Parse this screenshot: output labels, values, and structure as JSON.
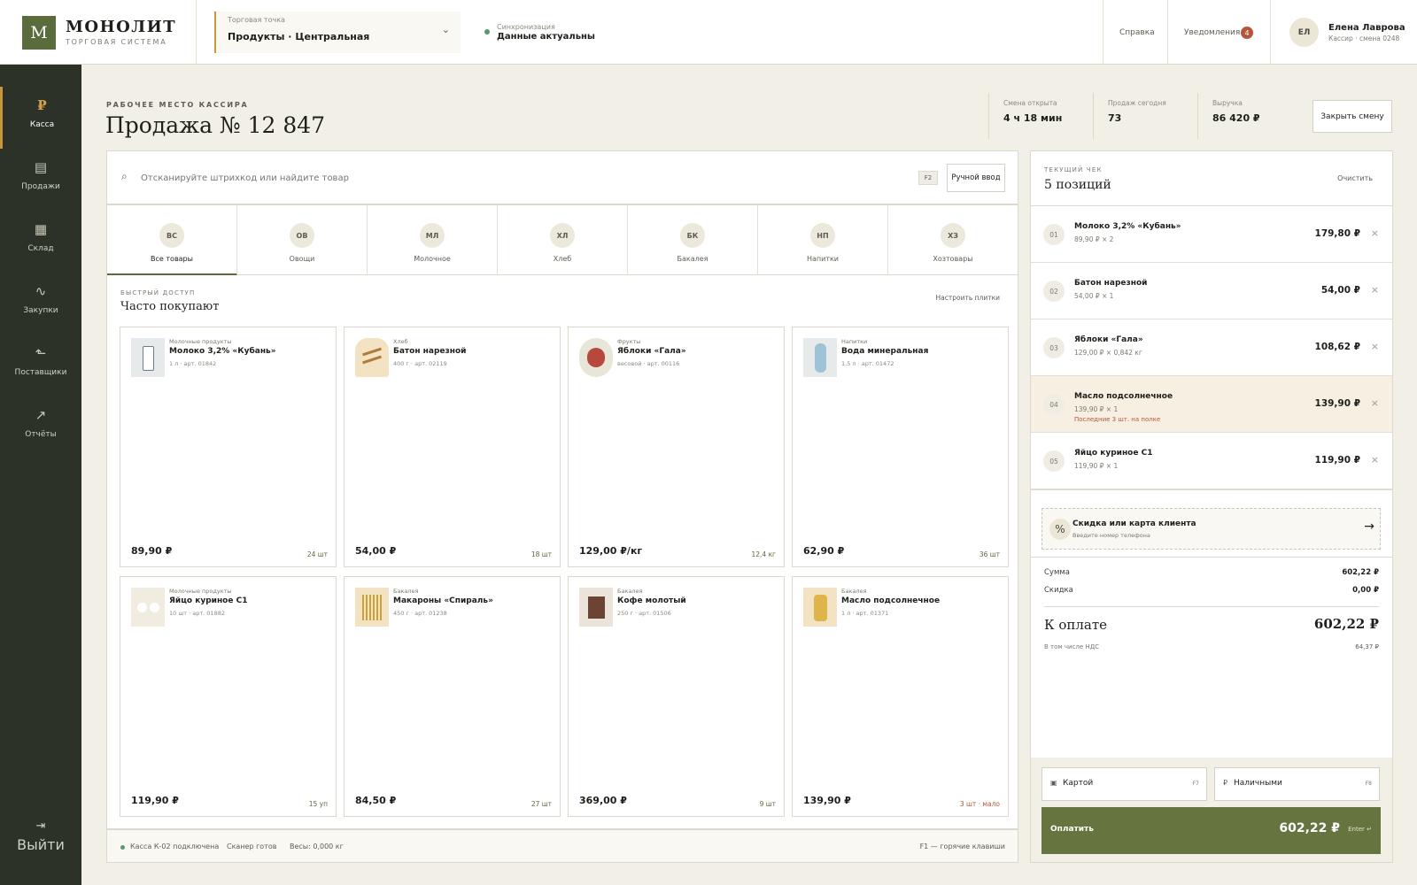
{
  "brand": {
    "logo": "М",
    "name": "МОНОЛИТ",
    "subtitle": "ТОРГОВАЯ СИСТЕМА"
  },
  "store": {
    "label": "Торговая точка",
    "value": "Продукты · Центральная"
  },
  "sync": {
    "label": "Синхронизация",
    "value": "Данные актуальны",
    "color": "#5a9a6a"
  },
  "header": {
    "help": "Справка",
    "notifications": "Уведомления",
    "notifications_count": "4"
  },
  "user": {
    "initials": "ЕЛ",
    "name": "Елена Лаврова",
    "role": "Кассир · смена 0248"
  },
  "sidebar": {
    "items": [
      {
        "icon": "ruble-icon",
        "glyph": "₽",
        "label": "Касса",
        "active": true
      },
      {
        "icon": "sales-icon",
        "glyph": "▤",
        "label": "Продажи"
      },
      {
        "icon": "warehouse-icon",
        "glyph": "▦",
        "label": "Склад"
      },
      {
        "icon": "purchases-icon",
        "glyph": "∿",
        "label": "Закупки"
      },
      {
        "icon": "suppliers-icon",
        "glyph": "⬑",
        "label": "Поставщики"
      },
      {
        "icon": "reports-icon",
        "glyph": "↗",
        "label": "Отчёты"
      }
    ],
    "logout": {
      "icon": "logout-icon",
      "glyph": "⇥",
      "label": "Выйти"
    }
  },
  "page": {
    "eyebrow": "РАБОЧЕЕ МЕСТО КАССИРА",
    "title": "Продажа № 12 847"
  },
  "stats": [
    {
      "label": "Смена открыта",
      "value": "4 ч 18 мин"
    },
    {
      "label": "Продаж сегодня",
      "value": "73"
    },
    {
      "label": "Выручка",
      "value": "86 420 ₽"
    }
  ],
  "close_shift": "Закрыть смену",
  "search": {
    "placeholder": "Отсканируйте штрихкод или найдите товар",
    "hotkey": "F2",
    "manual": "Ручной ввод"
  },
  "categories": [
    {
      "abbr": "ВС",
      "label": "Все товары",
      "active": true
    },
    {
      "abbr": "ОВ",
      "label": "Овощи"
    },
    {
      "abbr": "МЛ",
      "label": "Молочное"
    },
    {
      "abbr": "ХЛ",
      "label": "Хлеб"
    },
    {
      "abbr": "БК",
      "label": "Бакалея"
    },
    {
      "abbr": "НП",
      "label": "Напитки"
    },
    {
      "abbr": "ХЗ",
      "label": "Хозтовары"
    }
  ],
  "quick": {
    "eyebrow": "БЫСТРЫЙ ДОСТУП",
    "title": "Часто покупают",
    "configure": "Настроить плитки"
  },
  "products": [
    {
      "category": "Молочные продукты",
      "name": "Молоко 3,2% «Кубань»",
      "meta": "1 л · арт. 01842",
      "price": "89,90 ₽",
      "stock": "24 шт",
      "low": false,
      "thumb": "milk"
    },
    {
      "category": "Хлеб",
      "name": "Батон нарезной",
      "meta": "400 г · арт. 02119",
      "price": "54,00 ₽",
      "stock": "18 шт",
      "low": false,
      "thumb": "bread"
    },
    {
      "category": "Фрукты",
      "name": "Яблоки «Гала»",
      "meta": "весовой · арт. 00116",
      "price": "129,00 ₽/кг",
      "stock": "12,4 кг",
      "low": false,
      "thumb": "apple"
    },
    {
      "category": "Напитки",
      "name": "Вода минеральная",
      "meta": "1,5 л · арт. 01472",
      "price": "62,90 ₽",
      "stock": "36 шт",
      "low": false,
      "thumb": "water"
    },
    {
      "category": "Молочные продукты",
      "name": "Яйцо куриное С1",
      "meta": "10 шт · арт. 01882",
      "price": "119,90 ₽",
      "stock": "15 уп",
      "low": false,
      "thumb": "eggs"
    },
    {
      "category": "Бакалея",
      "name": "Макароны «Спираль»",
      "meta": "450 г · арт. 01238",
      "price": "84,50 ₽",
      "stock": "27 шт",
      "low": false,
      "thumb": "pasta"
    },
    {
      "category": "Бакалея",
      "name": "Кофе молотый",
      "meta": "250 г · арт. 01506",
      "price": "369,00 ₽",
      "stock": "9 шт",
      "low": false,
      "thumb": "coffee"
    },
    {
      "category": "Бакалея",
      "name": "Масло подсолнечное",
      "meta": "1 л · арт. 01371",
      "price": "139,90 ₽",
      "stock": "3 шт · мало",
      "low": true,
      "thumb": "oil"
    }
  ],
  "statusbar": {
    "register": "Касса К-02 подключена",
    "scanner": "Сканер готов",
    "scales": "Весы: 0,000 кг",
    "hotkeys": "F1 — горячие клавиши"
  },
  "receipt": {
    "eyebrow": "ТЕКУЩИЙ ЧЕК",
    "title": "5 позиций",
    "clear": "Очистить",
    "items": [
      {
        "num": "01",
        "name": "Молоко 3,2% «Кубань»",
        "qty": "89,90 ₽ × 2",
        "price": "179,80 ₽"
      },
      {
        "num": "02",
        "name": "Батон нарезной",
        "qty": "54,00 ₽ × 1",
        "price": "54,00 ₽"
      },
      {
        "num": "03",
        "name": "Яблоки «Гала»",
        "qty": "129,00 ₽ × 0,842 кг",
        "price": "108,62 ₽"
      },
      {
        "num": "04",
        "name": "Масло подсолнечное",
        "qty": "139,90 ₽ × 1",
        "warning": "Последние 3 шт. на полке",
        "price": "139,90 ₽",
        "highlight": true
      },
      {
        "num": "05",
        "name": "Яйцо куриное С1",
        "qty": "119,90 ₽ × 1",
        "price": "119,90 ₽"
      }
    ],
    "discount": {
      "title": "Скидка или карта клиента",
      "hint": "Введите номер телефона"
    },
    "sum_label": "Сумма",
    "sum": "602,22 ₽",
    "discount_label": "Скидка",
    "discount_value": "0,00 ₽",
    "total_label": "К оплате",
    "total": "602,22 ₽",
    "vat_label": "В том числе НДС",
    "vat": "64,37 ₽",
    "pay_card": "Картой",
    "pay_card_key": "F7",
    "pay_cash": "Наличными",
    "pay_cash_key": "F8",
    "pay_button": "Оплатить",
    "pay_amount": "602,22 ₽",
    "pay_key": "Enter ↵"
  },
  "colors": {
    "accent": "#5a6b3c",
    "gold": "#c9973b",
    "danger": "#b5553b",
    "sidebar": "#2c3227"
  }
}
